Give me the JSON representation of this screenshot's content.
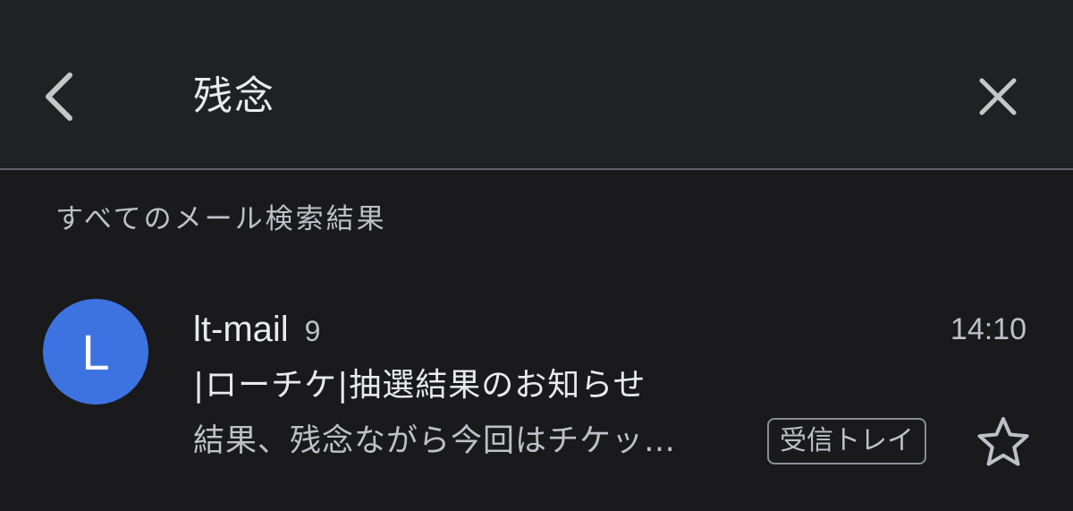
{
  "search": {
    "query": "残念",
    "back_icon": "chevron-left-icon",
    "clear_icon": "close-icon"
  },
  "results": {
    "section_label": "すべてのメール検索結果",
    "emails": [
      {
        "avatar_letter": "L",
        "avatar_color": "#3d73e0",
        "sender": "lt-mail",
        "thread_count": "9",
        "time": "14:10",
        "subject": "|ローチケ|抽選結果のお知らせ",
        "snippet": "結果、残念ながら今回はチケッ…",
        "label": "受信トレイ",
        "starred": false,
        "star_icon": "star-outline-icon"
      }
    ]
  },
  "colors": {
    "background": "#1a1a1c",
    "header_background": "#202124",
    "divider": "#5f6368",
    "primary_text": "#e8eaed",
    "secondary_text": "#bdc1c6"
  }
}
